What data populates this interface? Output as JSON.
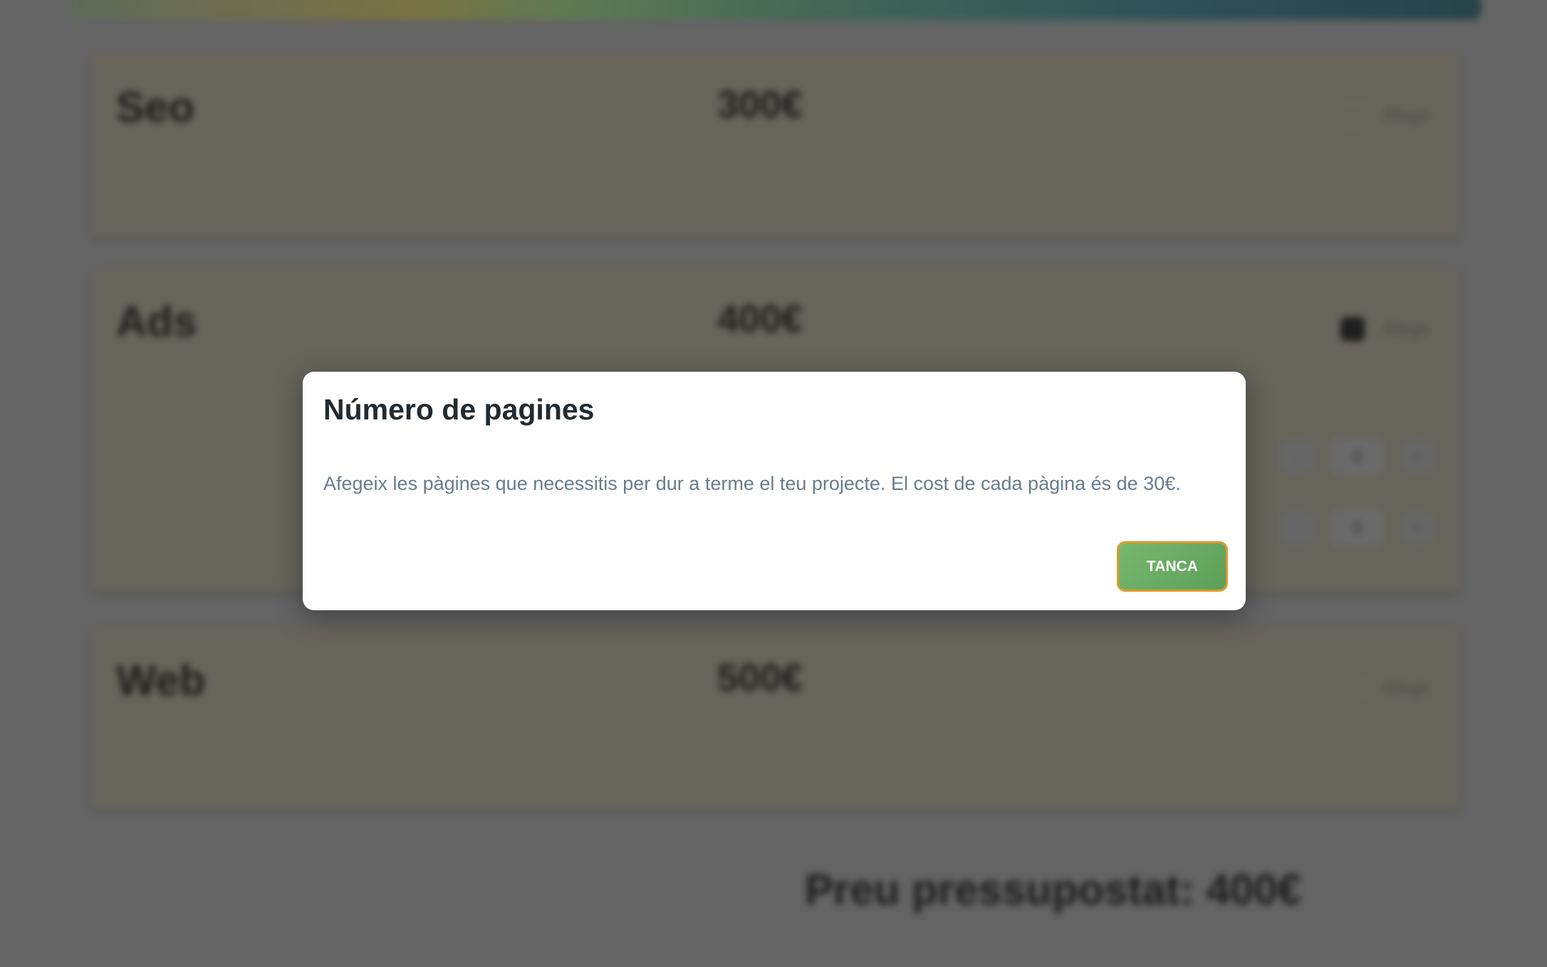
{
  "services": [
    {
      "name": "Seo",
      "price": "300€",
      "checkbox_label": "Afegir",
      "checked": false
    },
    {
      "name": "Ads",
      "price": "400€",
      "checkbox_label": "Afegir",
      "checked": true,
      "steppers": [
        {
          "label": "",
          "minus": "-",
          "value": "0",
          "plus": "+"
        },
        {
          "label": "",
          "minus": "-",
          "value": "0",
          "plus": "+"
        }
      ]
    },
    {
      "name": "Web",
      "price": "500€",
      "checkbox_label": "Afegir",
      "checked": false
    }
  ],
  "total": "Preu pressupostat: 400€",
  "modal": {
    "title": "Número de pagines",
    "body": "Afegeix les pàgines que necessitis per dur a terme el teu projecte. El cost de cada pàgina és de 30€.",
    "close_label": "TANCA"
  },
  "colors": {
    "button": "#6aab62",
    "button_border": "#e09a2e",
    "overlay": "#646464"
  }
}
